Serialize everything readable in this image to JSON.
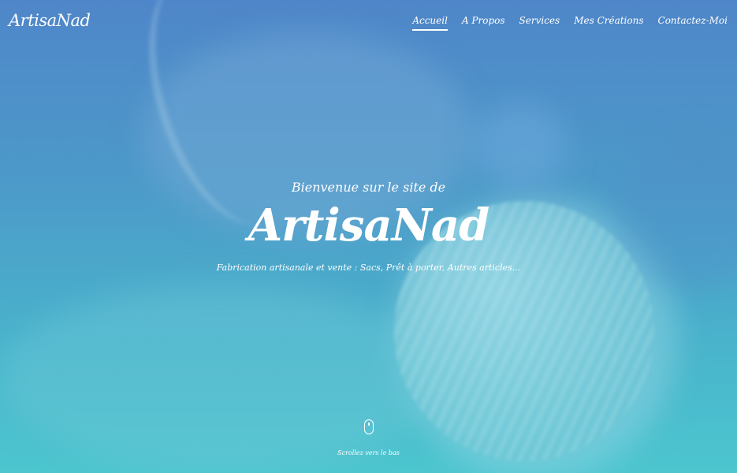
{
  "brand": {
    "name": "ArtisaNad"
  },
  "nav": {
    "items": [
      {
        "label": "Accueil",
        "active": true
      },
      {
        "label": "A Propos",
        "active": false
      },
      {
        "label": "Services",
        "active": false
      },
      {
        "label": "Mes Créations",
        "active": false
      },
      {
        "label": "Contactez-Moi",
        "active": false
      }
    ]
  },
  "hero": {
    "welcome": "Bienvenue sur le site de",
    "title": "ArtisaNad",
    "tagline": "Fabrication artisanale et vente : Sacs, Prêt à porter, Autres articles..."
  },
  "scroll": {
    "icon": "mouse-icon",
    "label": "Scrollez vers le bas"
  },
  "colors": {
    "gradient_top": "#4f86c9",
    "gradient_bottom": "#4cc6cf",
    "text": "#ffffff"
  }
}
